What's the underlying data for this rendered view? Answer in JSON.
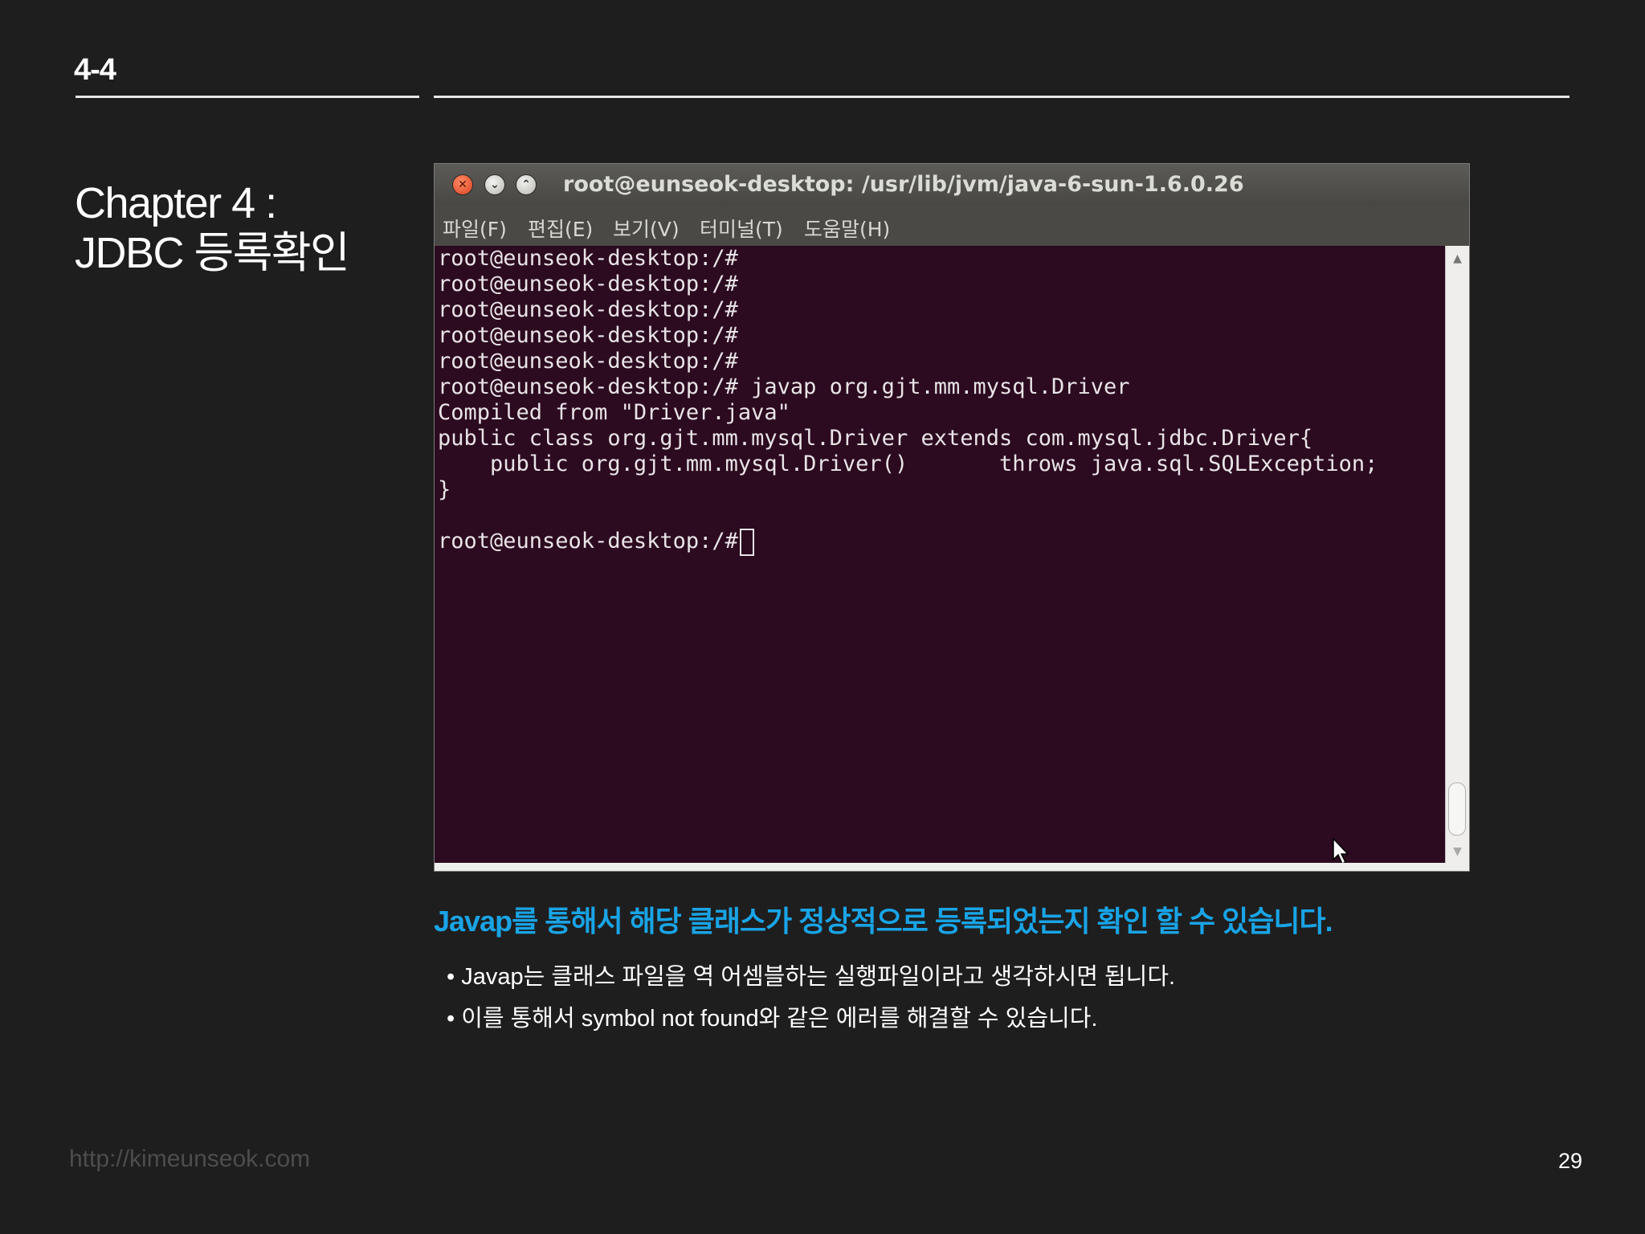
{
  "header": {
    "section_number": "4-4"
  },
  "chapter": {
    "line1": "Chapter 4 :",
    "line2": "JDBC 등록확인"
  },
  "terminal": {
    "title": "root@eunseok-desktop: /usr/lib/jvm/java-6-sun-1.6.0.26",
    "menu": [
      "파일(F)",
      "편집(E)",
      "보기(V)",
      "터미널(T)",
      "도움말(H)"
    ],
    "lines": [
      "root@eunseok-desktop:/#",
      "root@eunseok-desktop:/#",
      "root@eunseok-desktop:/#",
      "root@eunseok-desktop:/#",
      "root@eunseok-desktop:/#",
      "root@eunseok-desktop:/# javap org.gjt.mm.mysql.Driver",
      "Compiled from \"Driver.java\"",
      "public class org.gjt.mm.mysql.Driver extends com.mysql.jdbc.Driver{",
      "    public org.gjt.mm.mysql.Driver()       throws java.sql.SQLException;",
      "}",
      "",
      "root@eunseok-desktop:/# "
    ],
    "icons": {
      "close": "close-icon",
      "minimize": "minimize-icon",
      "maximize": "maximize-icon"
    },
    "colors": {
      "background": "#2c0a20",
      "text": "#e8e4e6"
    }
  },
  "content": {
    "highlight": "Javap를 통해서 해당 클래스가 정상적으로 등록되었는지 확인 할 수 있습니다.",
    "bullets": [
      "• Javap는 클래스 파일을 역 어셈블하는 실행파일이라고 생각하시면 됩니다.",
      "• 이를 통해서 symbol not found와 같은 에러를 해결할 수 있습니다."
    ],
    "highlight_color": "#19a4e6"
  },
  "footer": {
    "url": "http://kimeunseok.com",
    "page_number": "29"
  }
}
